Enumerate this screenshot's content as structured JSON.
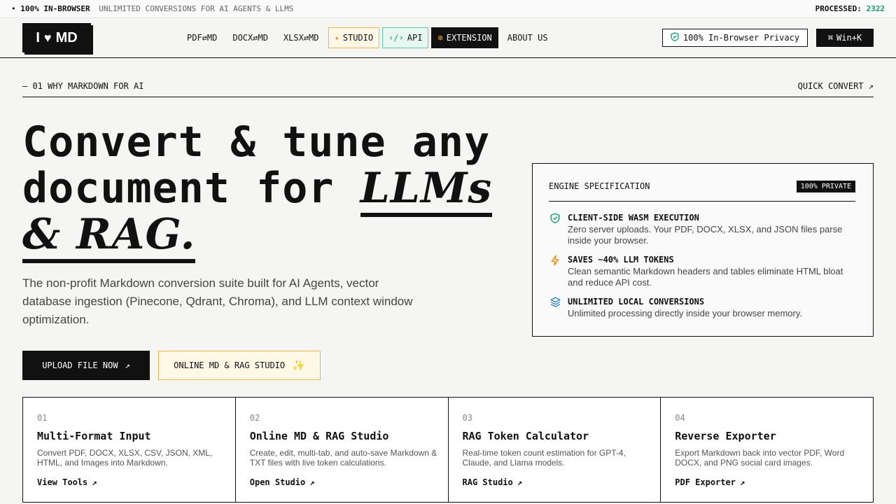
{
  "ribbon": {
    "bullet": "•",
    "highlight": "100% IN-BROWSER",
    "tagline": "UNLIMITED CONVERSIONS FOR AI AGENTS & LLMS",
    "processed_label": "PROCESSED:",
    "processed_count": "2322"
  },
  "logo": {
    "prefix": "I",
    "suffix": "MD"
  },
  "nav": {
    "links": [
      {
        "label": "PDF⇄MD"
      },
      {
        "label": "DOCX⇄MD"
      },
      {
        "label": "XLSX⇄MD"
      }
    ],
    "studio_label": "STUDIO",
    "api_label": "API",
    "extension_label": "EXTENSION",
    "about_label": "ABOUT US",
    "privacy_label": "100% In-Browser Privacy",
    "shortcut_label": "Win+K"
  },
  "section": {
    "label": "— 01 WHY MARKDOWN FOR AI",
    "quick_convert": "QUICK CONVERT"
  },
  "hero": {
    "title_plain": "Convert & tune any document for ",
    "title_em": "LLMs & RAG.",
    "subtitle": "The non-profit Markdown conversion suite built for AI Agents, vector database ingestion (Pinecone, Qdrant, Chroma), and LLM context window optimization.",
    "upload_label": "UPLOAD FILE NOW",
    "studio_label": "ONLINE MD & RAG STUDIO"
  },
  "spec": {
    "title": "ENGINE SPECIFICATION",
    "badge": "100% PRIVATE",
    "features": [
      {
        "title": "CLIENT-SIDE WASM EXECUTION",
        "desc": "Zero server uploads. Your PDF, DOCX, XLSX, and JSON files parse inside your browser."
      },
      {
        "title": "SAVES ~40% LLM TOKENS",
        "desc": "Clean semantic Markdown headers and tables eliminate HTML bloat and reduce API cost."
      },
      {
        "title": "UNLIMITED LOCAL CONVERSIONS",
        "desc": "Unlimited processing directly inside your browser memory."
      }
    ]
  },
  "colors": {
    "accent_green": "#0e9f6e",
    "accent_orange": "#e8890c",
    "ink": "#111111"
  },
  "cards": [
    {
      "num": "01",
      "title": "Multi-Format Input",
      "desc": "Convert PDF, DOCX, XLSX, CSV, JSON, XML, HTML, and Images into Markdown.",
      "link": "View Tools"
    },
    {
      "num": "02",
      "title": "Online MD & RAG Studio",
      "desc": "Create, edit, multi-tab, and auto-save Markdown & TXT files with live token calculations.",
      "link": "Open Studio"
    },
    {
      "num": "03",
      "title": "RAG Token Calculator",
      "desc": "Real-time token count estimation for GPT-4, Claude, and Llama models.",
      "link": "RAG Studio"
    },
    {
      "num": "04",
      "title": "Reverse Exporter",
      "desc": "Export Markdown back into vector PDF, Word DOCX, and PNG social card images.",
      "link": "PDF Exporter"
    }
  ]
}
